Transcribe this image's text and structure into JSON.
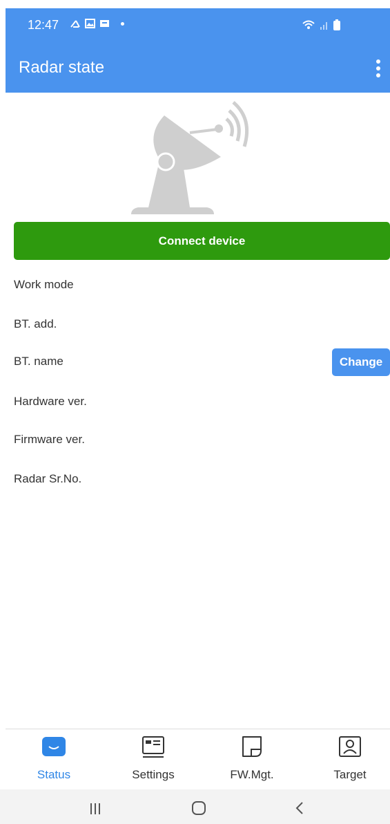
{
  "status_bar": {
    "time": "12:47",
    "left_icons": [
      "phone-missed-icon",
      "gallery-icon",
      "notification-icon"
    ],
    "right_icons": [
      "wifi-icon",
      "signal-icon",
      "battery-icon"
    ]
  },
  "app_bar": {
    "title": "Radar state",
    "menu_icon": "more-vert-icon"
  },
  "hero": {
    "icon": "radar-dish-icon"
  },
  "connect_button": {
    "label": "Connect device",
    "color": "#2e9a0e"
  },
  "info": {
    "work_mode_label": "Work mode",
    "bt_add_label": "BT. add.",
    "bt_name_label": "BT. name",
    "change_label": "Change",
    "hardware_label": "Hardware ver.",
    "firmware_label": "Firmware ver.",
    "serial_label": "Radar Sr.No."
  },
  "tabs": [
    {
      "label": "Status",
      "icon": "status-icon",
      "active": true
    },
    {
      "label": "Settings",
      "icon": "settings-icon",
      "active": false
    },
    {
      "label": "FW.Mgt.",
      "icon": "fw-mgt-icon",
      "active": false
    },
    {
      "label": "Target",
      "icon": "target-icon",
      "active": false
    }
  ],
  "nav": [
    "recents-icon",
    "home-icon",
    "back-icon"
  ],
  "colors": {
    "accent": "#4a93ee",
    "tab_active": "#2f86e6"
  }
}
